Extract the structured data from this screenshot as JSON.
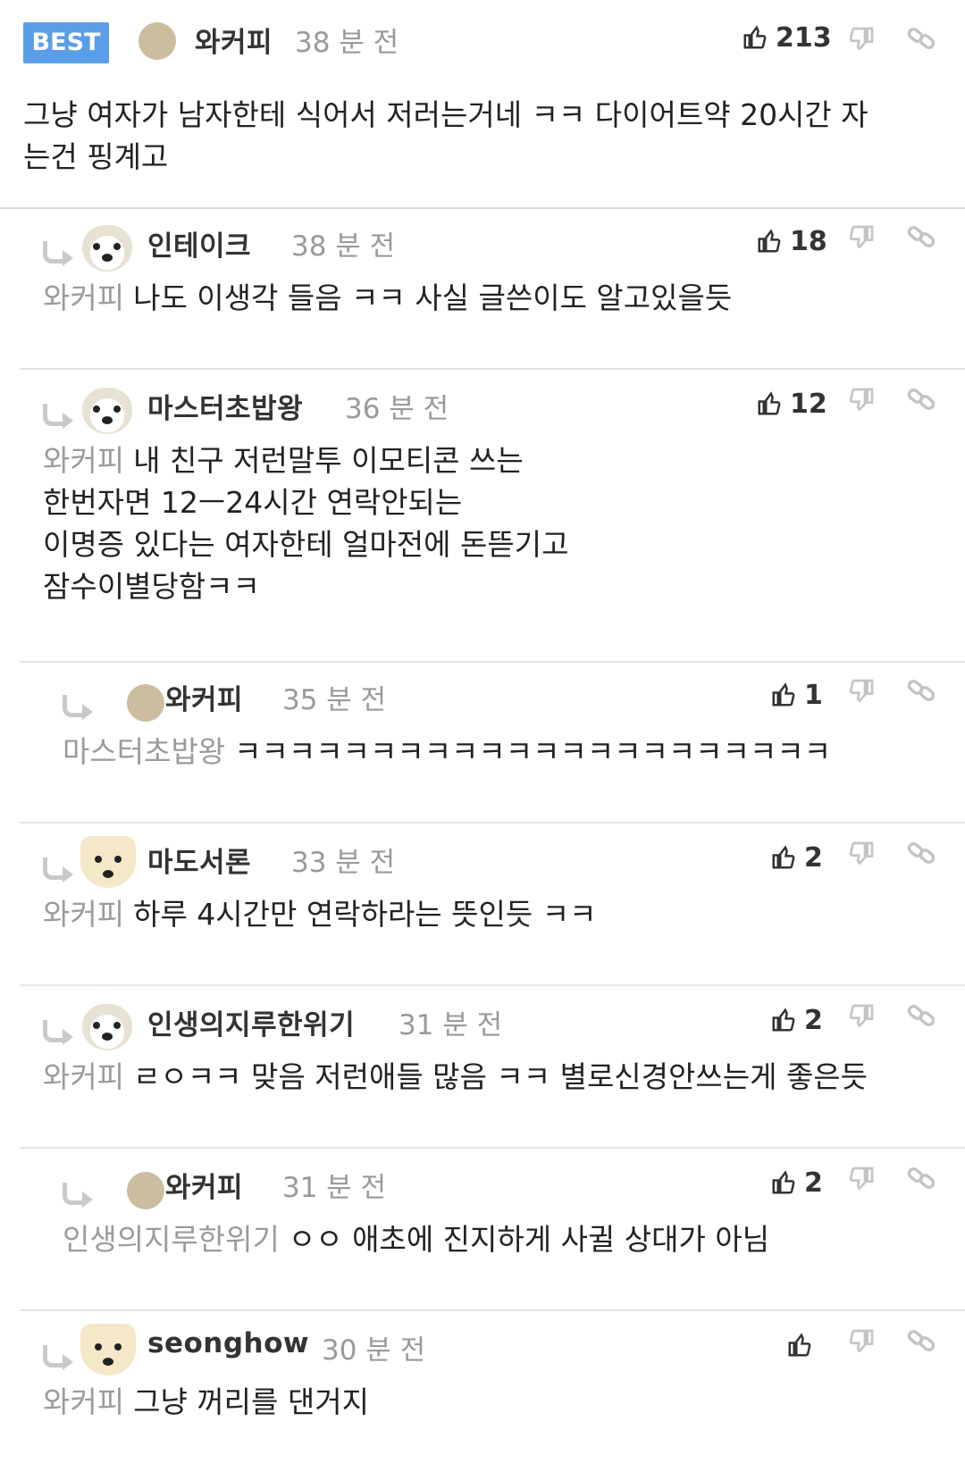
{
  "best": {
    "badge": "BEST",
    "author": "와커피",
    "time": "38 분 전",
    "likes": "213",
    "text_line1": "그냥 여자가 남자한테 식어서 저러는거네 ㅋㅋ 다이어트약 20시간 자",
    "text_line2": "는건 핑계고"
  },
  "replies": [
    {
      "author": "인테이크",
      "time": "38 분 전",
      "likes": "18",
      "mention": "와커피",
      "lines": [
        "나도 이생각 들음 ㅋㅋ 사실 글쓴이도 알고있을듯"
      ]
    },
    {
      "author": "마스터초밥왕",
      "time": "36 분 전",
      "likes": "12",
      "mention": "와커피",
      "lines": [
        "내 친구 저런말투 이모티콘 쓰는",
        "한번자면 12ㅡ24시간 연락안되는",
        "이명증 있다는 여자한테 얼마전에 돈뜯기고",
        "잠수이별당함ㅋㅋ"
      ]
    },
    {
      "author": "와커피",
      "time": "35 분 전",
      "likes": "1",
      "mention": "마스터초밥왕",
      "lines": [
        "ㅋㅋㅋㅋㅋㅋㅋㅋㅋㅋㅋㅋㅋㅋㅋㅋㅋㅋㅋㅋㅋㅋ"
      ]
    },
    {
      "author": "마도서론",
      "time": "33 분 전",
      "likes": "2",
      "mention": "와커피",
      "lines": [
        "하루 4시간만 연락하라는 뜻인듯 ㅋㅋ"
      ]
    },
    {
      "author": "인생의지루한위기",
      "time": "31 분 전",
      "likes": "2",
      "mention": "와커피",
      "lines": [
        "ㄹㅇㅋㅋ 맞음 저런애들 많음 ㅋㅋ 별로신경안쓰는게 좋은듯"
      ]
    },
    {
      "author": "와커피",
      "time": "31 분 전",
      "likes": "2",
      "mention": "인생의지루한위기",
      "lines": [
        "ㅇㅇ 애초에 진지하게 사귈 상대가 아님"
      ]
    },
    {
      "author": "seonghow",
      "time": "30 분 전",
      "likes": "",
      "mention": "와커피",
      "lines": [
        "그냥 꺼리를 댄거지"
      ]
    }
  ],
  "colors": {
    "badge": "#5b9ee8",
    "muted": "#9b9b9b",
    "divider": "#e4e4e4"
  },
  "icons": [
    "reply-arrow-icon",
    "thumbs-up-icon",
    "thumbs-down-icon",
    "link-icon"
  ]
}
